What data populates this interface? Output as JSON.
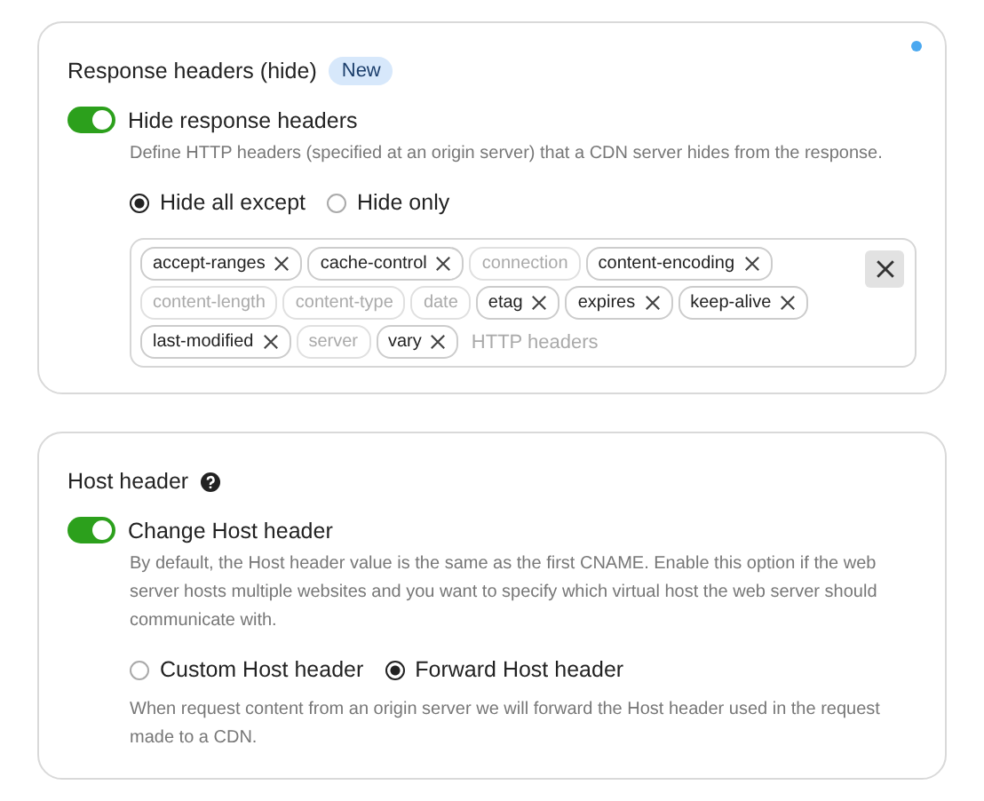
{
  "sections": [
    {
      "title": "Response headers (hide)",
      "badge": "New",
      "help": false,
      "dot": true,
      "toggle": {
        "label": "Hide response headers",
        "on": true
      },
      "description": "Define HTTP headers (specified at an origin server) that a CDN server hides from the response.",
      "radios": [
        {
          "label": "Hide all except",
          "selected": true
        },
        {
          "label": "Hide only",
          "selected": false
        }
      ],
      "tags": {
        "placeholder": "HTTP headers",
        "items": [
          {
            "label": "accept-ranges",
            "disabled": false
          },
          {
            "label": "cache-control",
            "disabled": false
          },
          {
            "label": "connection",
            "disabled": true
          },
          {
            "label": "content-encoding",
            "disabled": false
          },
          {
            "label": "content-length",
            "disabled": true
          },
          {
            "label": "content-type",
            "disabled": true
          },
          {
            "label": "date",
            "disabled": true
          },
          {
            "label": "etag",
            "disabled": false
          },
          {
            "label": "expires",
            "disabled": false
          },
          {
            "label": "keep-alive",
            "disabled": false
          },
          {
            "label": "last-modified",
            "disabled": false
          },
          {
            "label": "server",
            "disabled": true
          },
          {
            "label": "vary",
            "disabled": false
          }
        ]
      }
    },
    {
      "title": "Host header",
      "help": true,
      "dot": false,
      "toggle": {
        "label": "Change Host header",
        "on": true
      },
      "description": "By default, the Host header value is the same as the first CNAME. Enable this option if the web server hosts multiple websites and you want to specify which virtual host the web server should communicate with.",
      "radios": [
        {
          "label": "Custom Host header",
          "selected": false
        },
        {
          "label": "Forward Host header",
          "selected": true
        }
      ],
      "note": "When request content from an origin server we will forward the Host header used in the request made to a CDN."
    }
  ]
}
